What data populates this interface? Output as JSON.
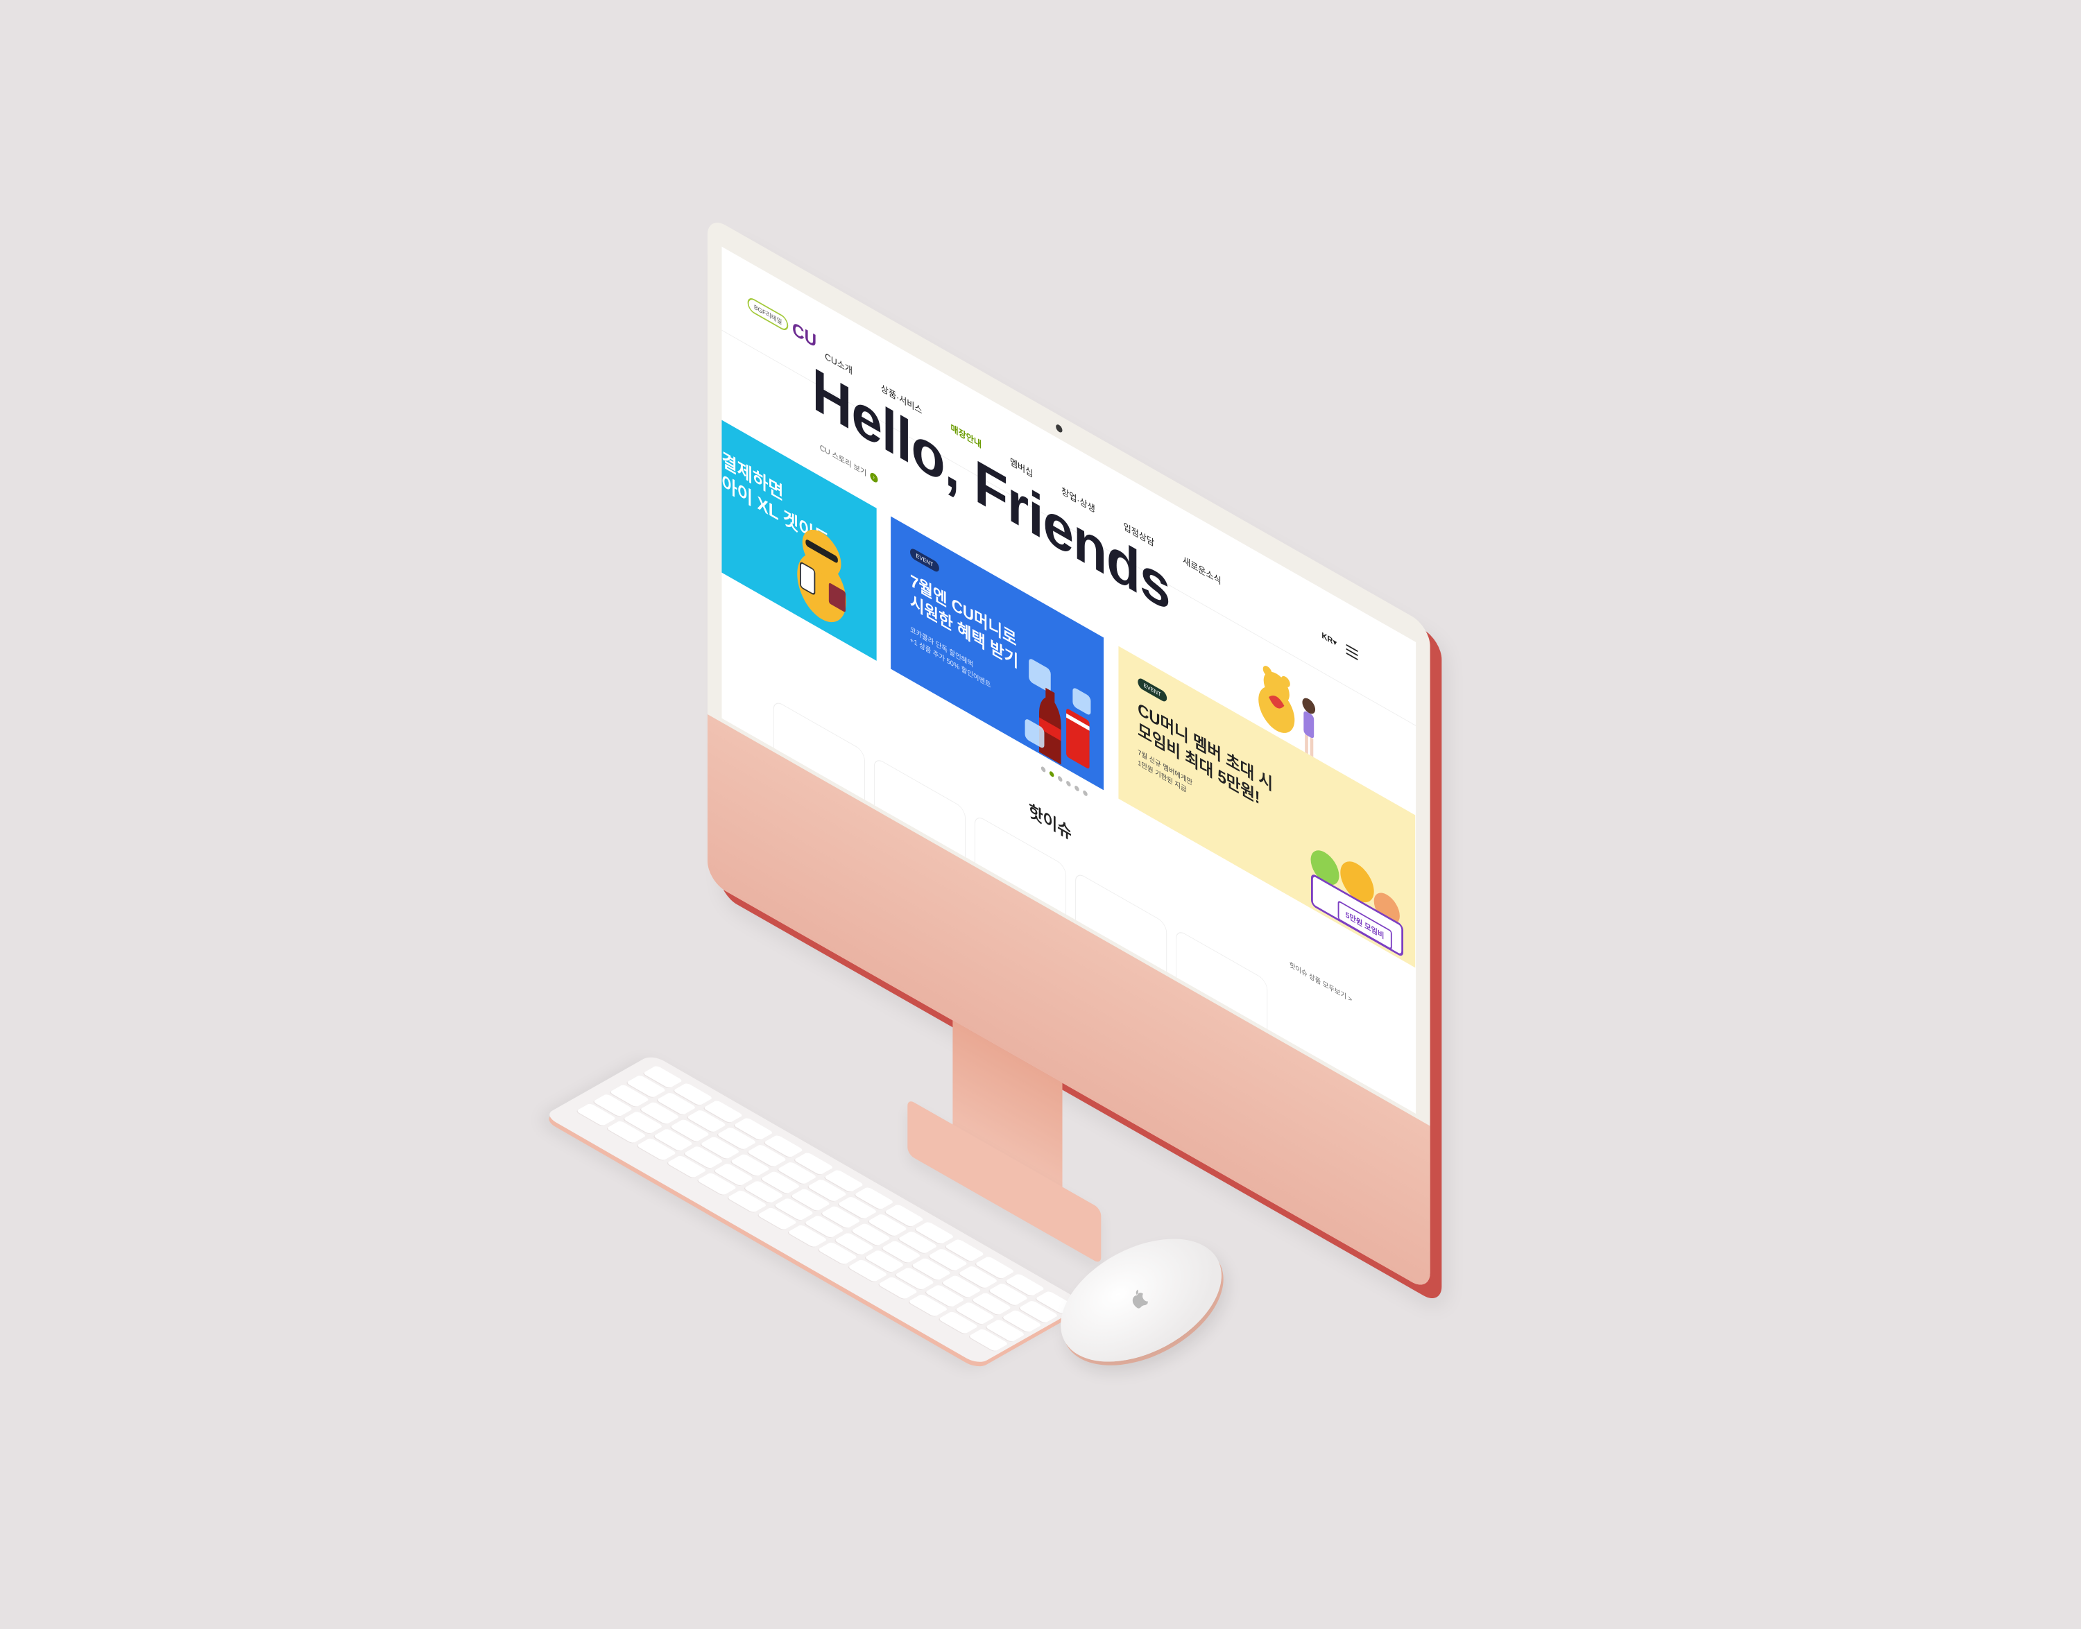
{
  "header": {
    "logo_badge": "BGF리테일",
    "logo_text": "CU",
    "nav": [
      "CU소개",
      "상품·서비스",
      "매장안내",
      "멤버십",
      "창업·상생",
      "입점상담",
      "새로운소식"
    ],
    "lang": "KR▾"
  },
  "hero": {
    "title": "Hello, Friends",
    "story_link": "CU 스토리 보기"
  },
  "banners": {
    "cyan": {
      "title": "결제하면\n아이 XL 겟이득"
    },
    "blue": {
      "pill": "EVENT",
      "title": "7월엔 CU머니로\n시원한 혜택 받기",
      "sub": "코카콜라 단독 할인혜택\n+1 상품 추가 50% 할인이벤트"
    },
    "yellow": {
      "pill": "EVENT",
      "title": "CU머니 멤버 초대 시\n모임비 최대 5만원!",
      "sub": "7월 신규 멤버에게만\n1만원 기한된 지급",
      "tag": "5만원 모임비"
    }
  },
  "carousel": {
    "count": 6,
    "active": 1
  },
  "hot_issue": {
    "title": "핫이슈",
    "more": "핫이슈 상품 모두보기 >"
  },
  "colors": {
    "bezel_red": "#c9504a",
    "chin_pink": "#eab3a3",
    "brand_purple": "#6c2c91",
    "brand_green": "#6a9b00",
    "banner_cyan": "#1cbde6",
    "banner_blue": "#2d73e6",
    "banner_yellow": "#fcefb8"
  }
}
